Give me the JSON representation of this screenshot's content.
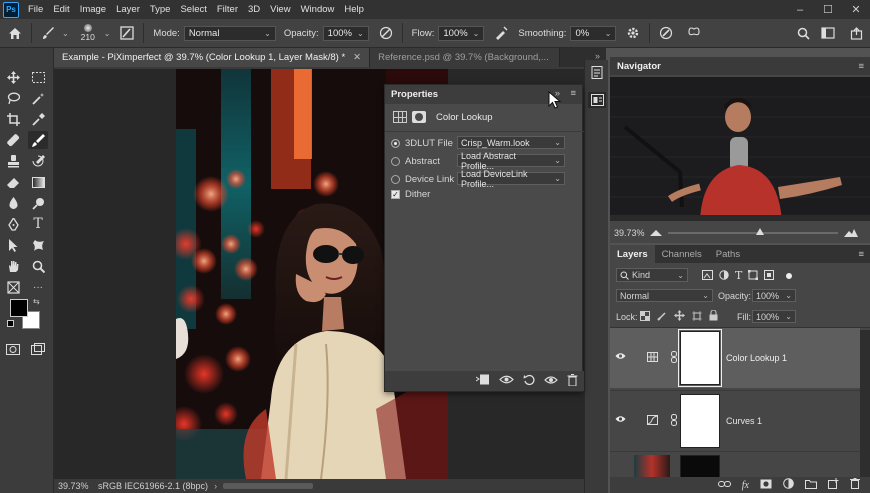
{
  "app": {
    "logo": "Ps"
  },
  "menu": [
    "File",
    "Edit",
    "Image",
    "Layer",
    "Type",
    "Select",
    "Filter",
    "3D",
    "View",
    "Window",
    "Help"
  ],
  "window_controls": {
    "minimize": "–",
    "maximize": "☐",
    "close": "✕"
  },
  "options_bar": {
    "brush_size": "210",
    "mode_label": "Mode:",
    "mode_value": "Normal",
    "opacity_label": "Opacity:",
    "opacity_value": "100%",
    "flow_label": "Flow:",
    "flow_value": "100%",
    "smoothing_label": "Smoothing:",
    "smoothing_value": "0%"
  },
  "tabs": [
    {
      "label": "Example - PiXimperfect @ 39.7% (Color Lookup 1, Layer Mask/8) *",
      "active": true
    },
    {
      "label": "Reference.psd @ 39.7% (Background,...",
      "active": false
    }
  ],
  "status": {
    "zoom": "39.73%",
    "profile": "sRGB IEC61966-2.1 (8bpc)"
  },
  "properties": {
    "title": "Properties",
    "subtitle": "Color Lookup",
    "options": [
      {
        "label": "3DLUT File",
        "value": "Crisp_Warm.look",
        "selected": true
      },
      {
        "label": "Abstract",
        "value": "Load Abstract Profile...",
        "selected": false
      },
      {
        "label": "Device Link",
        "value": "Load DeviceLink Profile...",
        "selected": false
      }
    ],
    "dither_label": "Dither",
    "dither_checked": true
  },
  "navigator": {
    "title": "Navigator",
    "zoom": "39.73%"
  },
  "layers_panel": {
    "tabs": [
      "Layers",
      "Channels",
      "Paths"
    ],
    "filter": "Kind",
    "blend_mode": "Normal",
    "opacity_label": "Opacity:",
    "opacity_value": "100%",
    "lock_label": "Lock:",
    "fill_label": "Fill:",
    "fill_value": "100%",
    "layers": [
      {
        "name": "Color Lookup 1",
        "selected": true
      },
      {
        "name": "Curves 1",
        "selected": false
      },
      {
        "name": "",
        "selected": false
      }
    ]
  },
  "colors": {
    "accent": "#31a8ff",
    "ui_dark": "#323232",
    "ui_panel": "#464646",
    "selected_layer": "#5e5e5e"
  }
}
